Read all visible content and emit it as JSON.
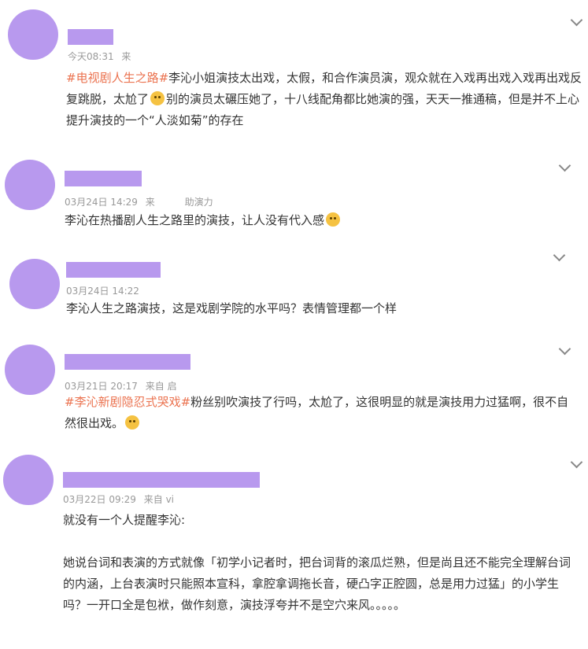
{
  "icons": {
    "expand": "chevron-down-icon",
    "emoji": "face-emoji-icon"
  },
  "colors": {
    "avatar": "#b899ee",
    "hashtag": "#eb7350",
    "meta": "#999999",
    "text": "#333333"
  },
  "comments": [
    {
      "time": "今天08:31",
      "source": "来",
      "hashtag": "#电视剧人生之路#",
      "text_a": "李沁小姐演技太出戏，太假，和合作演员演，观众就在入戏再出戏入戏再出戏反复跳脱，太尬了",
      "text_b": "别的演员太碾压她了，十八线配角都比她演的强，天天一推通稿，但是并不上心提升演技的一个“人淡如菊”的存在"
    },
    {
      "time": "03月24日 14:29",
      "source": "来",
      "source_tail": "助演力",
      "text_a": "李沁在热播剧人生之路里的演技，让人没有代入感"
    },
    {
      "time": "03月24日 14:22",
      "text_a": "李沁人生之路演技，这是戏剧学院的水平吗？表情管理都一个样"
    },
    {
      "time": "03月21日 20:17",
      "source": "来自 启",
      "hashtag": "#李沁新剧隐忍式哭戏#",
      "text_a": "粉丝别吹演技了行吗，太尬了，这很明显的就是演技用力过猛啊，很不自然很出戏。"
    },
    {
      "time": "03月22日 09:29",
      "source": "来自 vi",
      "line1": "就没有一个人提醒李沁:",
      "line2": "她说台词和表演的方式就像「初学小记者时，把台词背的滚瓜烂熟，但是尚且还不能完全理解台词的内涵，上台表演时只能照本宣科，拿腔拿调拖长音，硬凸字正腔圆，总是用力过猛」的小学生吗？一开口全是包袱，做作刻意，演技浮夸并不是空穴来风。。。。。"
    }
  ]
}
